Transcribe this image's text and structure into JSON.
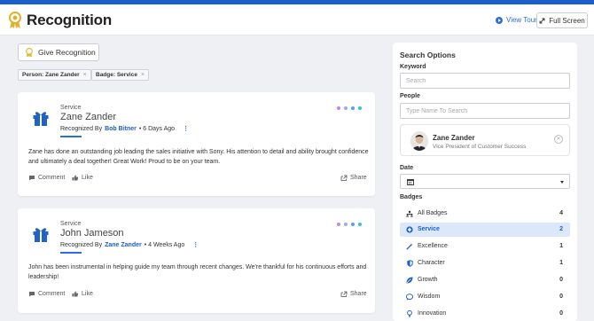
{
  "header": {
    "title": "Recognition",
    "view_tour": "View Tour",
    "full_screen": "Full Screen"
  },
  "toolbar": {
    "give_recognition": "Give Recognition",
    "filters": [
      {
        "label": "Person: Zane Zander",
        "remove": "×"
      },
      {
        "label": "Badge: Service",
        "remove": "×"
      }
    ]
  },
  "feed": [
    {
      "category": "Service",
      "recipient": "Zane Zander",
      "recognized_by_prefix": "Recognized By",
      "giver": "Bob Bitner",
      "time": "• 6 Days Ago",
      "message": "Zane has done an outstanding job leading the sales initiative with Sony. His attention to detail and ability brought confidence and ultimately a deal together! Great Work! Proud to be on your team.",
      "comment": "Comment",
      "like": "Like",
      "share": "Share",
      "dot_colors": [
        "#b98be6",
        "#9aa6f0",
        "#4fa3f0",
        "#34c3d6"
      ]
    },
    {
      "category": "Service",
      "recipient": "John Jameson",
      "recognized_by_prefix": "Recognized By",
      "giver": "Zane Zander",
      "time": "• 4 Weeks Ago",
      "message": "John has been instrumental in helping guide my team through recent changes. We're thankful for his continuous efforts and leadership!",
      "comment": "Comment",
      "like": "Like",
      "share": "Share",
      "dot_colors": [
        "#b98be6",
        "#9aa6f0",
        "#4fa3f0",
        "#34c3d6"
      ]
    }
  ],
  "sidebar": {
    "title": "Search Options",
    "keyword_label": "Keyword",
    "keyword_placeholder": "Search",
    "people_label": "People",
    "people_placeholder": "Type Name To Search",
    "person": {
      "name": "Zane Zander",
      "title": "Vice President of Customer Success"
    },
    "date_label": "Date",
    "badges_label": "Badges",
    "badges": [
      {
        "label": "All Badges",
        "count": "4",
        "icon": "people-group-icon",
        "active": false
      },
      {
        "label": "Service",
        "count": "2",
        "icon": "service-hand-icon",
        "active": true
      },
      {
        "label": "Excellence",
        "count": "1",
        "icon": "magic-wand-icon",
        "active": false
      },
      {
        "label": "Character",
        "count": "1",
        "icon": "shield-icon",
        "active": false
      },
      {
        "label": "Growth",
        "count": "0",
        "icon": "leaf-icon",
        "active": false
      },
      {
        "label": "Wisdom",
        "count": "0",
        "icon": "chat-bubble-icon",
        "active": false
      },
      {
        "label": "Innovation",
        "count": "0",
        "icon": "lightbulb-icon",
        "active": false
      }
    ]
  },
  "colors": {
    "accent": "#1a5fcc",
    "badge_blue": "#1f63c9",
    "active_row": "#dbe8fb"
  }
}
